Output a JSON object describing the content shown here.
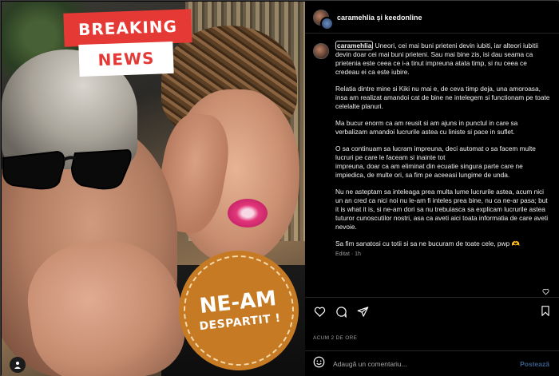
{
  "photo": {
    "breaking_label": "BREAKING",
    "news_label": "NEWS",
    "badge_line1": "NE-AM",
    "badge_line2": "DESPARTIT !"
  },
  "header": {
    "names": "caramehlia și keedonline"
  },
  "caption": {
    "username": "caramehlia",
    "paragraph1": "Uneori, cei mai buni prieteni devin iubiti, iar alteori iubitii devin doar cei mai buni prieteni. Sau mai bine zis, isi dau seama ca prietenia este ceea ce i-a tinut impreuna atata timp, si nu ceea ce credeau ei ca este iubire.",
    "paragraph2": "Relatia dintre mine si Kiki nu mai e, de ceva timp deja, una amoroasa, insa am realizat amandoi cat de bine ne intelegem si functionam pe toate celelalte planuri.",
    "paragraph3": "Ma bucur enorm ca am reusit si am ajuns in punctul in care sa verbalizam amandoi lucrurile astea cu liniste si pace in suflet.",
    "paragraph4a": "O sa continuam sa lucram impreuna, deci automat o sa facem multe lucruri pe care le faceam si inainte tot",
    "paragraph4b": "impreuna, doar ca am eliminat din ecuatie singura parte care ne impiedica, de multe ori, sa fim pe aceeasi lungime de unda.",
    "paragraph5": "Nu ne asteptam sa inteleaga prea multa lume lucrurile astea, acum nici un an cred ca nici noi nu le-am fi inteles prea bine, nu ca ne-ar pasa; but it is what it is, si ne-am dori sa nu trebuiasca sa explicam lucrurile astea tuturor cunoscutilor nostri, asa ca aveti aici toata informatia de care aveti nevoie.",
    "paragraph6": "Sa fim sanatosi cu totii si sa ne bucuram de toate cele, pwp 🫶",
    "edited": "Editat · 1h"
  },
  "date_label": "ACUM 2 DE ORE",
  "comment": {
    "placeholder": "Adaugă un comentariu...",
    "post_label": "Postează"
  },
  "icons": [
    "user-tag-icon",
    "heart-icon",
    "comment-icon",
    "share-icon",
    "bookmark-icon",
    "emoji-icon"
  ],
  "colors": {
    "breaking_red": "#e53935",
    "badge_orange": "#c67a24",
    "post_button_blue": "#3b5e8a"
  }
}
